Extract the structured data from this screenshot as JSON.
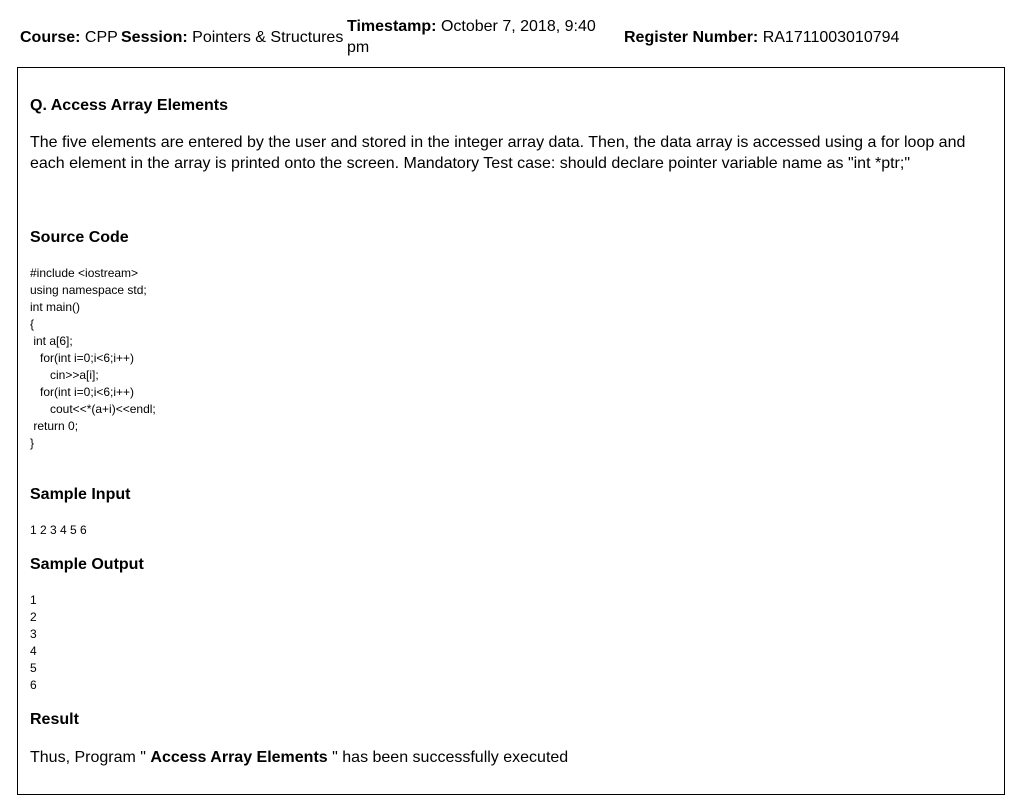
{
  "header": {
    "course_label": "Course:",
    "course_value": "CPP",
    "session_label": "Session:",
    "session_value": "Pointers & Structures",
    "timestamp_label": "Timestamp:",
    "timestamp_value": "October 7, 2018, 9:40 pm",
    "register_label": "Register Number:",
    "register_value": "RA1711003010794"
  },
  "question": {
    "title": "Q. Access Array Elements",
    "description": "The five elements are entered by the user and stored in the integer array data. Then, the data array is accessed using a for loop and each element in the array is printed onto the screen. Mandatory Test case: should declare pointer variable name as \"int *ptr;\""
  },
  "source_code": {
    "heading": "Source Code",
    "code": "#include <iostream>\nusing namespace std;\nint main()\n{\n int a[6];\n   for(int i=0;i<6;i++)\n      cin>>a[i];\n   for(int i=0;i<6;i++)\n      cout<<*(a+i)<<endl;\n return 0;\n}"
  },
  "sample_input": {
    "heading": "Sample Input",
    "text": "1 2 3 4 5 6"
  },
  "sample_output": {
    "heading": "Sample Output",
    "text": "1\n2\n3\n4\n5\n6"
  },
  "result": {
    "heading": "Result",
    "prefix": "Thus, Program \"",
    "program_name": "Access Array Elements",
    "suffix": "\" has been successfully executed"
  }
}
